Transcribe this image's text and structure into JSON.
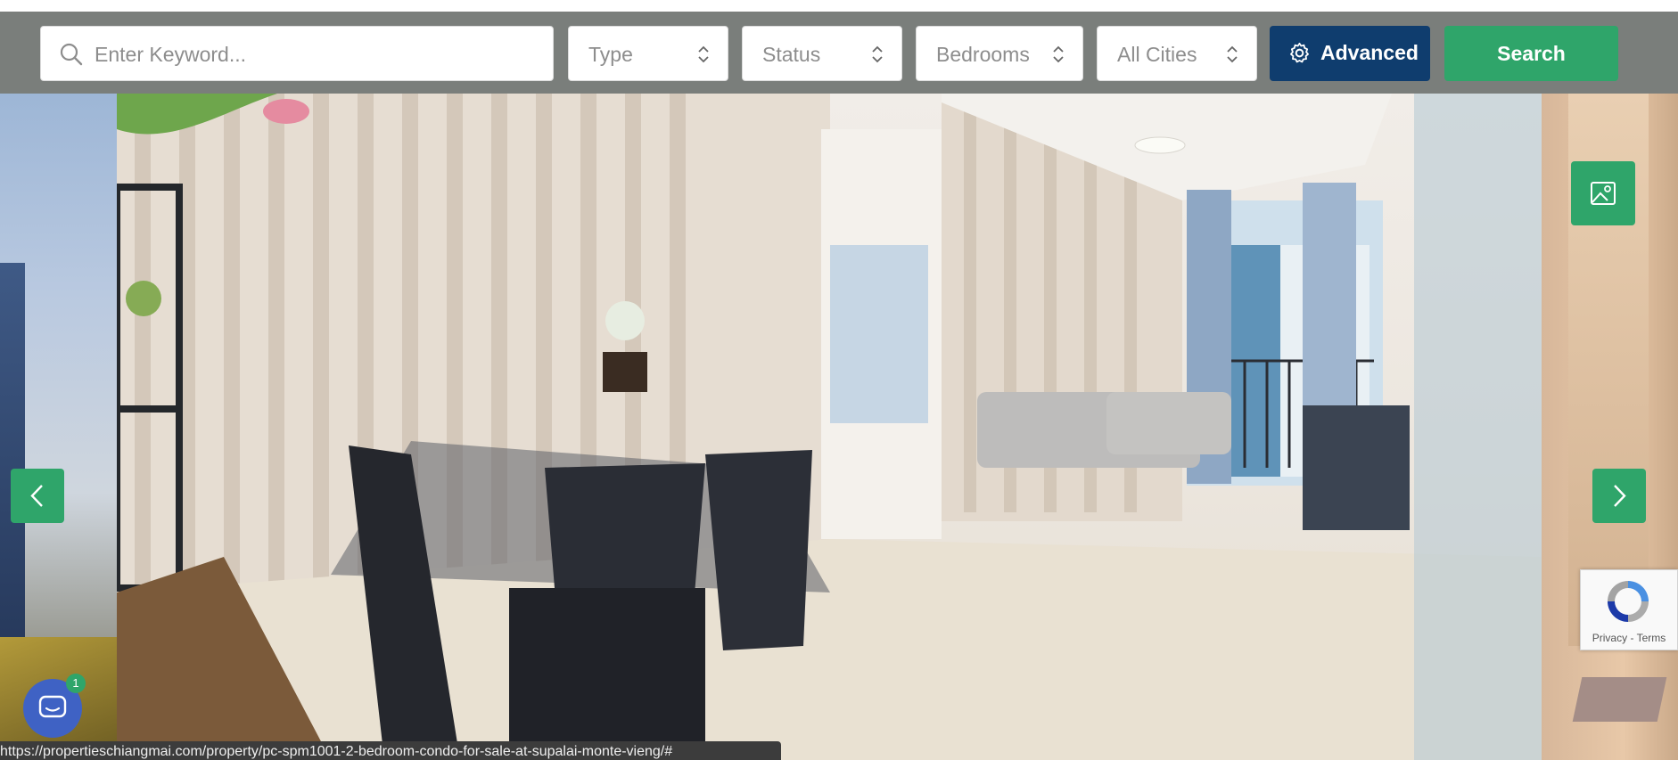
{
  "search": {
    "keyword_placeholder": "Enter Keyword...",
    "filters": {
      "type": "Type",
      "status": "Status",
      "bedrooms": "Bedrooms",
      "cities": "All Cities"
    },
    "advanced_label": "Advanced",
    "search_label": "Search"
  },
  "recaptcha": {
    "privacy": "Privacy",
    "separator": " - ",
    "terms": "Terms"
  },
  "chat": {
    "badge_count": "1"
  },
  "status_url": "https://propertieschiangmai.com/property/pc-spm1001-2-bedroom-condo-for-sale-at-supalai-monte-vieng/#",
  "colors": {
    "brand_green": "#2fa56a",
    "advanced_blue": "#0f3d6e",
    "bar_gray": "#7a7e7b"
  },
  "icons": {
    "search": "search-icon",
    "chevron": "chevron-updown-icon",
    "gear": "gear-icon",
    "prev": "chevron-left-icon",
    "next": "chevron-right-icon",
    "photo": "image-gallery-icon",
    "chat": "chat-icon"
  }
}
